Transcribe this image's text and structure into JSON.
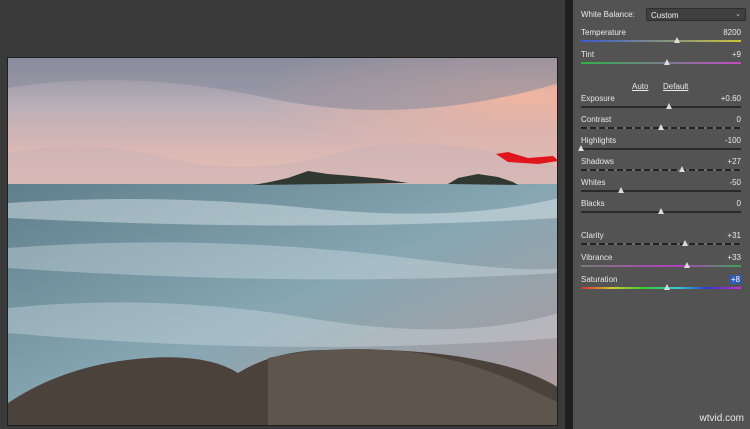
{
  "white_balance": {
    "label": "White Balance:",
    "value": "Custom"
  },
  "sliders_wb": [
    {
      "id": "temperature",
      "label": "Temperature",
      "value": "8200",
      "pos": 0.6,
      "track": "temp"
    },
    {
      "id": "tint",
      "label": "Tint",
      "value": "+9",
      "pos": 0.54,
      "track": "tint"
    }
  ],
  "tone_links": {
    "auto": "Auto",
    "default": "Default"
  },
  "sliders_tone": [
    {
      "id": "exposure",
      "label": "Exposure",
      "value": "+0.60",
      "pos": 0.55,
      "track": "plain"
    },
    {
      "id": "contrast",
      "label": "Contrast",
      "value": "0",
      "pos": 0.5,
      "track": "dashed"
    },
    {
      "id": "highlights",
      "label": "Highlights",
      "value": "-100",
      "pos": 0.0,
      "track": "plain"
    },
    {
      "id": "shadows",
      "label": "Shadows",
      "value": "+27",
      "pos": 0.63,
      "track": "dashed"
    },
    {
      "id": "whites",
      "label": "Whites",
      "value": "-50",
      "pos": 0.25,
      "track": "plain"
    },
    {
      "id": "blacks",
      "label": "Blacks",
      "value": "0",
      "pos": 0.5,
      "track": "plain"
    }
  ],
  "sliders_presence": [
    {
      "id": "clarity",
      "label": "Clarity",
      "value": "+31",
      "pos": 0.65,
      "track": "dashed"
    },
    {
      "id": "vibrance",
      "label": "Vibrance",
      "value": "+33",
      "pos": 0.66,
      "track": "vib"
    },
    {
      "id": "saturation",
      "label": "Saturation",
      "value": "+8",
      "pos": 0.54,
      "track": "sat",
      "highlighted": true
    }
  ],
  "watermark": "wtvid.com"
}
